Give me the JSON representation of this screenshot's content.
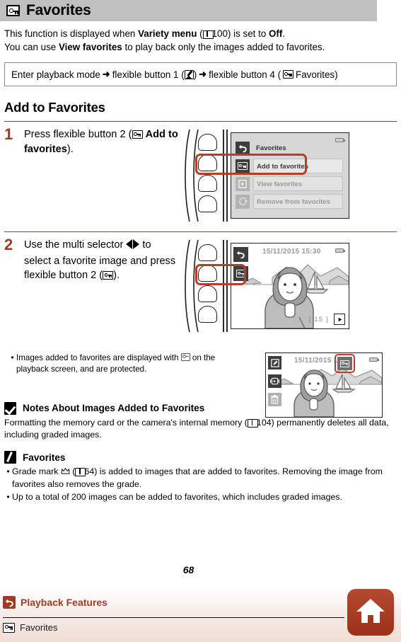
{
  "header": {
    "icon": "key-favorites-icon",
    "title": "Favorites"
  },
  "intro": {
    "line1_a": "This function is displayed when ",
    "line1_b": "Variety menu",
    "line1_c": " (",
    "line1_page": "100",
    "line1_d": ") is set to ",
    "line1_e": "Off",
    "line1_f": ".",
    "line2_a": "You can use ",
    "line2_b": "View favorites",
    "line2_c": " to play back only the images added to favorites."
  },
  "path_box": {
    "seg1": "Enter playback mode",
    "arrow": "➜",
    "seg2": "flexible button 1 (",
    "seg2_close": ")",
    "seg3": "flexible button 4 (",
    "seg3_label": "Favorites)"
  },
  "section_heading": "Add to Favorites",
  "steps": [
    {
      "number": "1",
      "text_a": "Press flexible button 2 (",
      "text_bold": "Add to favorites",
      "text_c": ").",
      "menu": {
        "battery": "battery-icon",
        "items": [
          {
            "label": "Favorites",
            "icon": "back-arrow-icon",
            "style": "title"
          },
          {
            "label": "Add to favorites",
            "icon": "key-favorites-icon",
            "style": "active"
          },
          {
            "label": "View favorites",
            "icon": "play-icon",
            "style": "dim"
          },
          {
            "label": "Remove from favorites",
            "icon": "dotted-circle-icon",
            "style": "dim"
          }
        ]
      }
    },
    {
      "number": "2",
      "text_a": "Use the multi selector ",
      "text_b": " to select a favorite image and press flexible button 2 (",
      "text_c": ").",
      "lcd": {
        "date": "15/11/2015 15:30",
        "counter": "[    15 ]",
        "side_icons": [
          "back-arrow-icon",
          "key-favorites-icon"
        ],
        "corner_icon": "play-icon",
        "battery": "battery-icon"
      }
    }
  ],
  "bullet_note": {
    "line_a": "Images added to favorites are displayed with ",
    "line_b": " on the playback screen, and are protected.",
    "icon": "favorites-badge-icon",
    "lcd": {
      "date": "15/11/2015 15:30",
      "side_icons": [
        "edit-icon",
        "slideshow-icon",
        "trash-icon"
      ],
      "highlight_icon": "favorites-badge-icon",
      "battery": "battery-icon"
    }
  },
  "notes": {
    "icon": "check-box-icon",
    "title": "Notes About Images Added to Favorites",
    "body_a": "Formatting the memory card or the camera's internal memory (",
    "body_page": "104",
    "body_b": ") permanently deletes all data, including graded images."
  },
  "tip": {
    "icon": "pencil-box-icon",
    "title": "Favorites",
    "bullets": [
      {
        "a": "Grade mark ",
        "icon": "crown-grade-icon",
        "b": " (",
        "page": "64",
        "c": ") is added to images that are added to favorites. Removing the image from favorites also removes the grade."
      },
      {
        "a": "Up to a total of 200 images can be added to favorites, which includes graded images.",
        "icon": null,
        "b": "",
        "page": "",
        "c": ""
      }
    ]
  },
  "page_number": "68",
  "footer": {
    "back_link": "Playback Features",
    "back_icon": "back-arrow-icon",
    "current_title": "Favorites",
    "current_icon": "key-favorites-icon",
    "home_icon": "home-icon"
  },
  "colors": {
    "accent_red": "#a03824",
    "header_gray": "#c0c0c0",
    "ring_red": "#b93d24",
    "footer_tint": "#f0ddd5"
  }
}
